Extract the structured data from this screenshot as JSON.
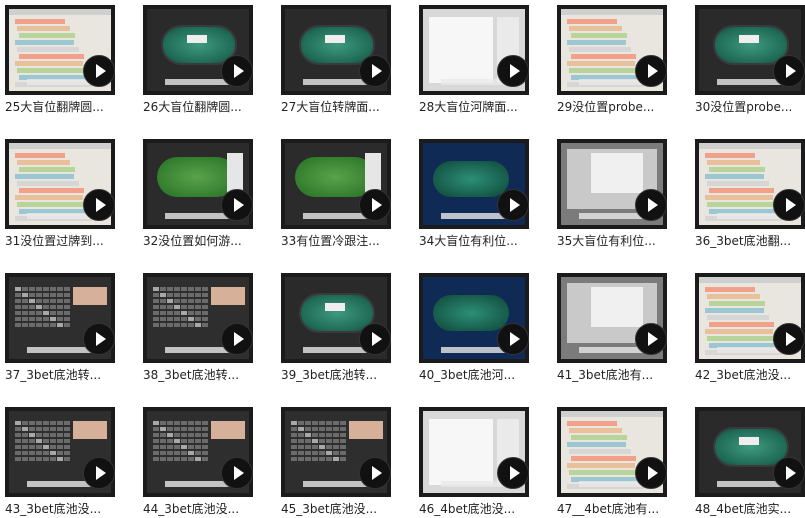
{
  "tiles": [
    {
      "caption": "25大盲位翻牌圆...",
      "style": "spreadsheet"
    },
    {
      "caption": "26大盲位翻牌圆...",
      "style": "table"
    },
    {
      "caption": "27大盲位转牌面...",
      "style": "table"
    },
    {
      "caption": "28大盲位河牌面...",
      "style": "form"
    },
    {
      "caption": "29没位置probe...",
      "style": "spreadsheet"
    },
    {
      "caption": "30没位置probe...",
      "style": "table"
    },
    {
      "caption": "31没位置过牌到...",
      "style": "spreadsheet"
    },
    {
      "caption": "32没位置如何游...",
      "style": "green"
    },
    {
      "caption": "33有位置冷跟注...",
      "style": "green"
    },
    {
      "caption": "34大盲位有利位...",
      "style": "blue"
    },
    {
      "caption": "35大盲位有利位...",
      "style": "grey"
    },
    {
      "caption": "36_3bet底池翻...",
      "style": "spreadsheet"
    },
    {
      "caption": "37_3bet底池转...",
      "style": "dark"
    },
    {
      "caption": "38_3bet底池转...",
      "style": "dark"
    },
    {
      "caption": "39_3bet底池转...",
      "style": "table"
    },
    {
      "caption": "40_3bet底池河...",
      "style": "blue"
    },
    {
      "caption": "41_3bet底池有...",
      "style": "grey"
    },
    {
      "caption": "42_3bet底池没...",
      "style": "spreadsheet"
    },
    {
      "caption": "43_3bet底池没...",
      "style": "dark"
    },
    {
      "caption": "44_3bet底池没...",
      "style": "dark"
    },
    {
      "caption": "45_3bet底池没...",
      "style": "dark"
    },
    {
      "caption": "46_4bet底池没...",
      "style": "form"
    },
    {
      "caption": "47__4bet底池有...",
      "style": "spreadsheet"
    },
    {
      "caption": "48_4bet底池实...",
      "style": "table"
    }
  ]
}
